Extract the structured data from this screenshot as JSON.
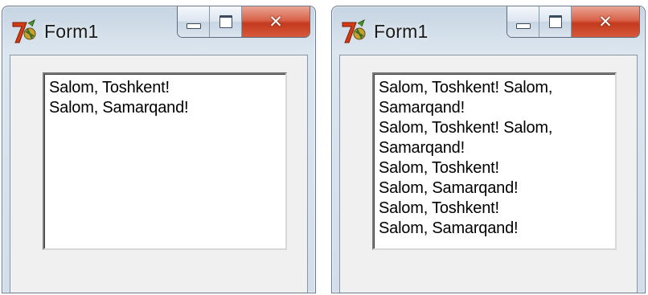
{
  "windows": [
    {
      "title": "Form1",
      "memo_lines": [
        "Salom, Toshkent!",
        "Salom, Samarqand!"
      ]
    },
    {
      "title": "Form1",
      "memo_lines": [
        "Salom, Toshkent! Salom,",
        "Samarqand!",
        "Salom, Toshkent! Salom,",
        "Samarqand!",
        "Salom, Toshkent!",
        "Salom, Samarqand!",
        "Salom, Toshkent!",
        "Salom, Samarqand!"
      ]
    }
  ],
  "icons": {
    "app": "delphi-app-icon",
    "minimize": "minimize-icon",
    "maximize": "maximize-icon",
    "close": "close-icon"
  },
  "colors": {
    "close_button": "#c8452a",
    "frame": "#d3dee9",
    "client": "#f0f0f0",
    "memo_background": "#ffffff"
  }
}
